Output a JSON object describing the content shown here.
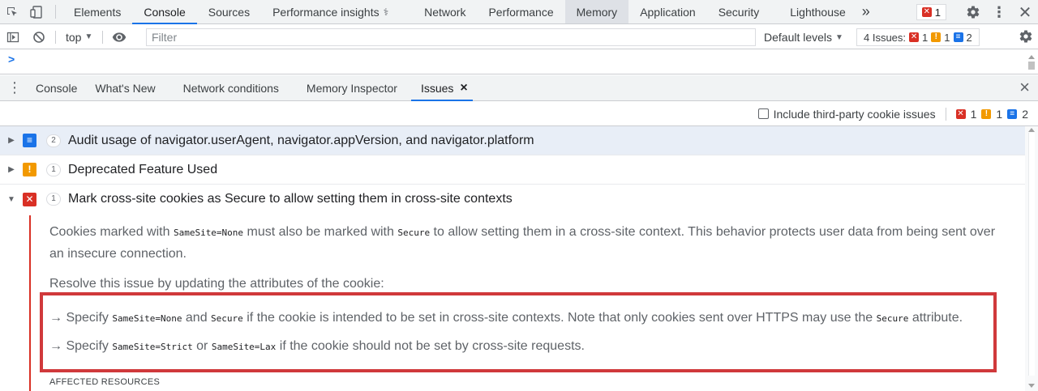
{
  "tabs": [
    "Elements",
    "Console",
    "Sources",
    "Performance insights",
    "Network",
    "Performance",
    "Memory",
    "Application",
    "Security",
    "Lighthouse"
  ],
  "tab_more": "»",
  "error_badge_count": "1",
  "console_toolbar": {
    "context": "top",
    "filter_placeholder": "Filter",
    "default_levels": "Default levels",
    "issues_label": "4 Issues:",
    "issues_error": "1",
    "issues_warning": "1",
    "issues_info": "2"
  },
  "prompt_caret": ">",
  "drawer": {
    "tabs": [
      "Console",
      "What's New",
      "Network conditions",
      "Memory Inspector",
      "Issues"
    ],
    "close_issues_tab": "×",
    "close_drawer": "×"
  },
  "issues_toolbar": {
    "checkbox_label": "Include third-party cookie issues",
    "error": "1",
    "warning": "1",
    "info": "2"
  },
  "issues": [
    {
      "count": "2",
      "title": "Audit usage of navigator.userAgent, navigator.appVersion, and navigator.platform",
      "kind": "info"
    },
    {
      "count": "1",
      "title": "Deprecated Feature Used",
      "kind": "warning"
    },
    {
      "count": "1",
      "title": "Mark cross-site cookies as Secure to allow setting them in cross-site contexts",
      "kind": "error"
    }
  ],
  "details": {
    "p1_a": "Cookies marked with ",
    "p1_code1": "SameSite=None",
    "p1_b": " must also be marked with ",
    "p1_code2": "Secure",
    "p1_c": " to allow setting them in a cross-site context. This behavior protects user data from being sent over an insecure connection.",
    "p2": "Resolve this issue by updating the attributes of the cookie:",
    "li1_a": "→ Specify ",
    "li1_code1": "SameSite=None",
    "li1_b": " and ",
    "li1_code2": "Secure",
    "li1_c": " if the cookie is intended to be set in cross-site contexts. Note that only cookies sent over HTTPS may use the ",
    "li1_code3": "Secure",
    "li1_d": " attribute.",
    "li2_a": "→ Specify ",
    "li2_code1": "SameSite=Strict",
    "li2_b": " or ",
    "li2_code2": "SameSite=Lax",
    "li2_c": " if the cookie should not be set by cross-site requests.",
    "affected": "AFFECTED RESOURCES"
  },
  "colors": {
    "accent": "#1a73e8",
    "error": "#d93025",
    "warning": "#f29900",
    "highlight_box": "#d0393b"
  }
}
